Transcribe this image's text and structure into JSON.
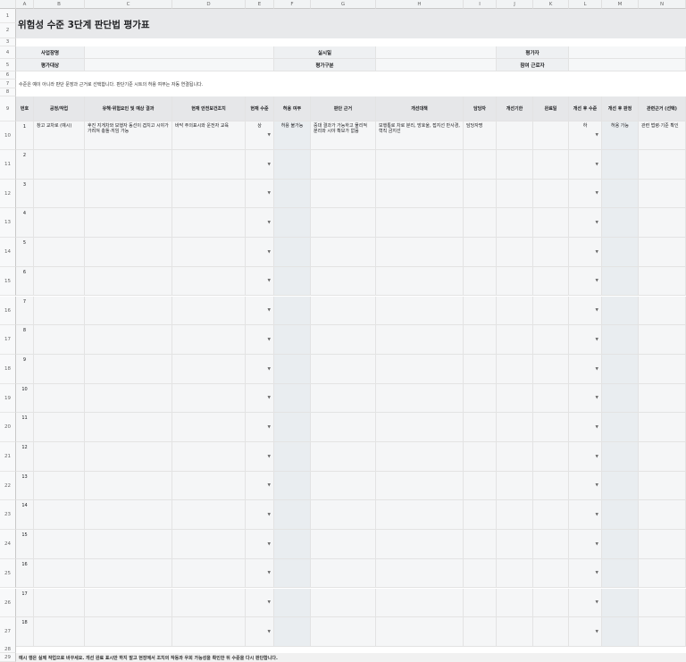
{
  "columns": [
    "A",
    "B",
    "C",
    "D",
    "E",
    "F",
    "G",
    "H",
    "I",
    "J",
    "K",
    "L",
    "M",
    "N"
  ],
  "rows": [
    "1",
    "2",
    "3",
    "4",
    "5",
    "6",
    "7",
    "8",
    "9",
    "10",
    "11",
    "12",
    "13",
    "14",
    "15",
    "16",
    "17",
    "18",
    "19",
    "20",
    "21",
    "22",
    "23",
    "24",
    "25",
    "26",
    "27",
    "28",
    "29"
  ],
  "title": "위험성 수준 3단계 판단법 평가표",
  "info": {
    "workplace_label": "사업장명",
    "date_label": "실시일",
    "evaluator_label": "평가자",
    "target_label": "평가대상",
    "type_label": "평가구분",
    "worker_label": "참여 근로자"
  },
  "note_row7": "수준은 예이 아니라 판단 문장과 근거로 선택합니다. 판단기준 시트의 허용 여부는 자동 연결됩니다.",
  "table_headers": {
    "no": "번호",
    "process": "공정/작업",
    "hazard": "유해·위험요인 및 예상 결과",
    "current_measure": "현재 안전보건조치",
    "current_level": "현재 수준",
    "allow": "허용 여부",
    "reason": "판단 근거",
    "improve": "개선대책",
    "manager": "담당자",
    "due": "개선기한",
    "done": "완료일",
    "after_level": "개선 후 수준",
    "after_judge": "개선 후 판정",
    "related": "관련근거 (선택)"
  },
  "example_row": {
    "no": "1",
    "process": "창고 교차로 (예시)",
    "hazard": "후진 지게차와 보행자 동선이 겹치고 시야가 가려져 충돌·끼임 가능",
    "current_measure": "바닥 주의표시와 운전자 교육",
    "current_level": "상",
    "allow": "허용 불가능",
    "reason": "중대 결과가 가능하고 물리적 분리와 시야 확보가 없음",
    "improve": "보행통로 차로 분리, 방호울, 접지선 반사경, 혁직 금지선",
    "manager": "담당자명",
    "after_level": "하",
    "after_judge": "허용 가능",
    "related": "관련 법령·기준 확인"
  },
  "empty_row_numbers": [
    "2",
    "3",
    "4",
    "5",
    "6",
    "7",
    "8",
    "9",
    "10",
    "11",
    "12",
    "13",
    "14",
    "15",
    "16",
    "17",
    "18"
  ],
  "footer_note": "예시 행은 실제 작업으로 바꾸세요. 개선 완료 표시만 하지 말고 현장에서 조치의 작동과 우회 가능성을 확인한 뒤 수준을 다시 판단합니다."
}
